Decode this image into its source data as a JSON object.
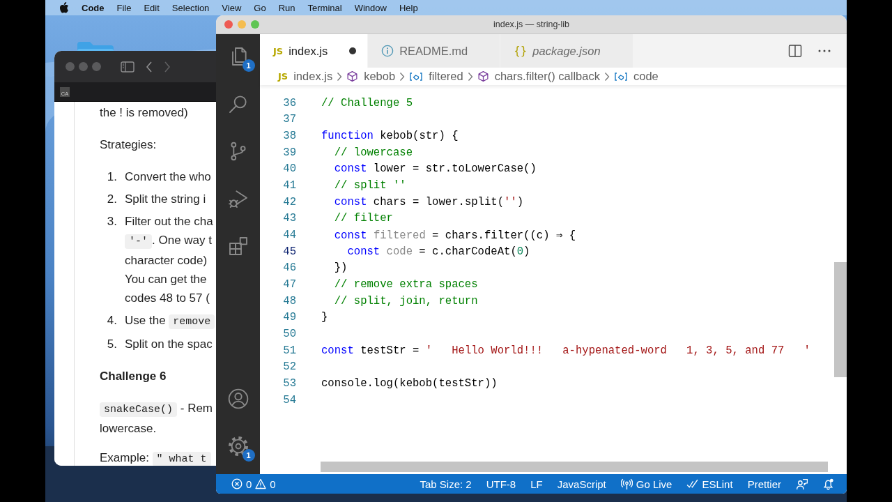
{
  "menu_bar": {
    "app": "Code",
    "items": [
      "File",
      "Edit",
      "Selection",
      "View",
      "Go",
      "Run",
      "Terminal",
      "Window",
      "Help"
    ]
  },
  "doc_window": {
    "site_label": "CA",
    "blocks": [
      {
        "kind": "paragraph",
        "lines": [
          [
            {
              "kind": "text",
              "text": "the ! is removed)"
            }
          ]
        ]
      },
      {
        "kind": "paragraph",
        "lines": [
          [
            {
              "kind": "text",
              "text": "Strategies:"
            }
          ]
        ]
      },
      {
        "kind": "list",
        "items": [
          {
            "number": "1.",
            "lines": [
              [
                {
                  "kind": "text",
                  "text": "Convert the who"
                }
              ]
            ]
          },
          {
            "number": "2.",
            "lines": [
              [
                {
                  "kind": "text",
                  "text": "Split the string i"
                }
              ]
            ]
          },
          {
            "number": "3.",
            "lines": [
              [
                {
                  "kind": "text",
                  "text": "Filter out the cha"
                }
              ],
              [
                {
                  "kind": "code",
                  "text": "'-'"
                },
                {
                  "kind": "text",
                  "text": ". One way t"
                }
              ],
              [
                {
                  "kind": "text",
                  "text": "character code)"
                }
              ],
              [
                {
                  "kind": "text",
                  "text": "You can get the"
                }
              ],
              [
                {
                  "kind": "text",
                  "text": "codes 48 to 57 ("
                }
              ]
            ]
          },
          {
            "number": "4.",
            "lines": [
              [
                {
                  "kind": "text",
                  "text": "Use the "
                },
                {
                  "kind": "code",
                  "text": "remove"
                }
              ]
            ]
          },
          {
            "number": "5.",
            "lines": [
              [
                {
                  "kind": "text",
                  "text": "Split on the spac"
                }
              ]
            ]
          }
        ]
      },
      {
        "kind": "heading",
        "lines": [
          [
            {
              "kind": "text",
              "text": "Challenge 6"
            }
          ]
        ]
      },
      {
        "kind": "paragraph",
        "lines": [
          [
            {
              "kind": "code",
              "text": "snakeCase()"
            },
            {
              "kind": "text",
              "text": " - Rem"
            }
          ],
          [
            {
              "kind": "text",
              "text": "lowercase."
            }
          ]
        ]
      },
      {
        "kind": "paragraph",
        "lines": [
          [
            {
              "kind": "text",
              "text": "Example: "
            },
            {
              "kind": "code",
              "text": "\" what t"
            }
          ]
        ]
      }
    ]
  },
  "editor_window": {
    "title": "index.js — string-lib",
    "activity_bar": [
      {
        "kind": "files",
        "badge": "1"
      },
      {
        "kind": "search"
      },
      {
        "kind": "branch"
      },
      {
        "kind": "debug"
      },
      {
        "kind": "extensions"
      },
      {
        "kind": "account"
      },
      {
        "kind": "settings",
        "badge": "1"
      }
    ],
    "tabs": [
      {
        "label": "index.js",
        "kind": "js",
        "icon_label": "JS",
        "selected": true,
        "modified": true,
        "preview": false
      },
      {
        "label": "README.md",
        "kind": "info",
        "selected": false,
        "modified": false,
        "preview": false
      },
      {
        "label": "package.json",
        "kind": "json",
        "icon_label": "{}",
        "selected": false,
        "modified": false,
        "preview": true
      }
    ],
    "breadcrumbs": [
      {
        "label": "index.js",
        "kind": "file",
        "icon_label": "JS"
      },
      {
        "label": "kebob",
        "kind": "function"
      },
      {
        "label": "filtered",
        "kind": "variable"
      },
      {
        "label": "chars.filter() callback",
        "kind": "function"
      },
      {
        "label": "code",
        "kind": "variable"
      }
    ],
    "lines": [
      {
        "number": "36",
        "current": false,
        "tokens": [
          {
            "kind": "comment",
            "text": "// Challenge 5"
          }
        ]
      },
      {
        "number": "37",
        "current": false
      },
      {
        "number": "38",
        "current": false,
        "tokens": [
          {
            "kind": "keyword",
            "text": "function"
          },
          {
            "kind": "plain",
            "text": " kebob(str) {"
          }
        ]
      },
      {
        "number": "39",
        "current": false,
        "tokens": [
          {
            "kind": "comment",
            "text": "  // lowercase"
          }
        ]
      },
      {
        "number": "40",
        "current": false,
        "tokens": [
          {
            "kind": "keyword",
            "text": "  const"
          },
          {
            "kind": "plain",
            "text": " lower = str.toLowerCase()"
          }
        ]
      },
      {
        "number": "41",
        "current": false,
        "tokens": [
          {
            "kind": "comment",
            "text": "  // split ''"
          }
        ]
      },
      {
        "number": "42",
        "current": false,
        "tokens": [
          {
            "kind": "keyword",
            "text": "  const"
          },
          {
            "kind": "plain",
            "text": " chars = lower.split("
          },
          {
            "kind": "string",
            "text": "''"
          },
          {
            "kind": "plain",
            "text": ")"
          }
        ]
      },
      {
        "number": "43",
        "current": false,
        "tokens": [
          {
            "kind": "comment",
            "text": "  // filter"
          }
        ]
      },
      {
        "number": "44",
        "current": false,
        "tokens": [
          {
            "kind": "keyword",
            "text": "  const "
          },
          {
            "kind": "unused",
            "text": "filtered"
          },
          {
            "kind": "plain",
            "text": " = chars.filter((c) ⇒ {"
          }
        ]
      },
      {
        "number": "45",
        "current": true,
        "tokens": [
          {
            "kind": "keyword",
            "text": "    const "
          },
          {
            "kind": "unused",
            "text": "code"
          },
          {
            "kind": "plain",
            "text": " = c.charCodeAt("
          },
          {
            "kind": "number",
            "text": "0"
          },
          {
            "kind": "plain",
            "text": ")"
          }
        ]
      },
      {
        "number": "46",
        "current": false,
        "tokens": [
          {
            "kind": "plain",
            "text": "  })"
          }
        ]
      },
      {
        "number": "47",
        "current": false,
        "tokens": [
          {
            "kind": "comment",
            "text": "  // remove extra spaces"
          }
        ]
      },
      {
        "number": "48",
        "current": false,
        "tokens": [
          {
            "kind": "comment",
            "text": "  // split, join, return"
          }
        ]
      },
      {
        "number": "49",
        "current": false,
        "tokens": [
          {
            "kind": "plain",
            "text": "}"
          }
        ]
      },
      {
        "number": "50",
        "current": false
      },
      {
        "number": "51",
        "current": false,
        "tokens": [
          {
            "kind": "keyword",
            "text": "const"
          },
          {
            "kind": "plain",
            "text": " testStr = "
          },
          {
            "kind": "string",
            "text": "'   Hello World!!!   a-hypenated-word   1, 3, 5, and 77   '"
          }
        ]
      },
      {
        "number": "52",
        "current": false
      },
      {
        "number": "53",
        "current": false,
        "tokens": [
          {
            "kind": "plain",
            "text": "console.log(kebob(testStr))"
          }
        ]
      },
      {
        "number": "54",
        "current": false
      }
    ],
    "status_bar": {
      "errors": "0",
      "warnings": "0",
      "items": [
        {
          "kind": "text",
          "text": "Tab Size: 2"
        },
        {
          "kind": "text",
          "text": "UTF-8"
        },
        {
          "kind": "text",
          "text": "LF"
        },
        {
          "kind": "text",
          "text": "JavaScript"
        },
        {
          "kind": "broadcast",
          "text": "Go Live"
        },
        {
          "kind": "checks",
          "text": "ESLint"
        },
        {
          "kind": "text",
          "text": "Prettier"
        },
        {
          "kind": "feedback"
        },
        {
          "kind": "bell"
        }
      ]
    }
  }
}
